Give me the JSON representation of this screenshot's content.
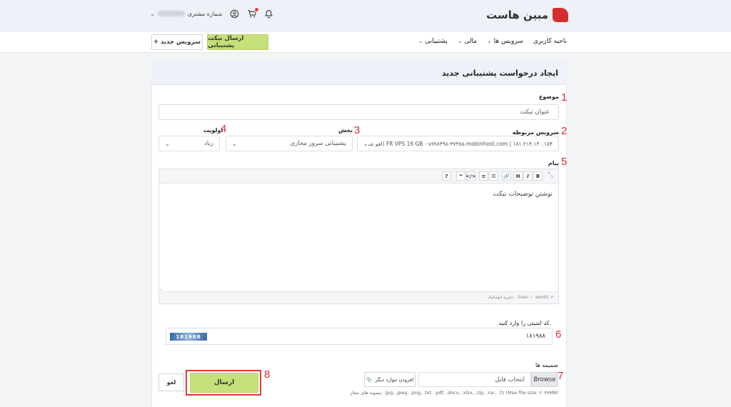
{
  "header": {
    "brand": "مبین هاست",
    "customer_label": "شماره مشتری",
    "icons": [
      "user-circle-icon",
      "cart-icon",
      "bell-icon"
    ]
  },
  "nav": {
    "items": [
      "ناحیه کاربری",
      "سرویس ها",
      "مالی",
      "پشتیبانی"
    ],
    "submit_ticket": "ارسال تیکت پشتیبانی",
    "new_service": "+ سرویس جدید"
  },
  "panel": {
    "title": "ایجاد درخواست پشتیبانی جدید",
    "subject_label": "موضوع",
    "subject_placeholder": "عنوان تیکت",
    "service_label": "سرویس مربوطه",
    "service_value": "FR VPS 16 GB - vm۸۳۹۸-۳۷۳۸۵.mobinhost.com | ۱۸۱.۲۱۴.۱۴۰.۱۵۴ (لغو شده)",
    "department_label": "بخش",
    "department_value": "پشتیبانی سرور مجازی",
    "priority_label": "اولویت",
    "priority_value": "زیاد",
    "message_label": "پیام",
    "message_placeholder": "نوشتن توضیحات تیکت",
    "editor_footer": {
      "words": "words: ۳",
      "lines": "lines: ۱",
      "autosave": "ذخیره اتوماتیک"
    },
    "captcha_label": "کد امنیتی را وارد کنید.",
    "captcha_value": "۱۸۱۹۸۸",
    "captcha_image_text": "181988",
    "attachments_label": "ضمیمه ها",
    "browse": "Browse",
    "file_placeholder": "انتخاب فایل",
    "add_more": "افزودن موارد دیگر",
    "allowed_ext": "پسوند های مجاز: .jpg, .jpeg, .png, .txt, .pdf, .docx, .xlsx, .zip, .rar, .7z (Max file size: ۲۰۴۸MB)",
    "submit": "ارسال",
    "cancel": "لغو"
  },
  "annotations": [
    "1",
    "2",
    "3",
    "4",
    "5",
    "6",
    "7",
    "8"
  ],
  "colors": {
    "accent_green": "#c6e07a",
    "annotation_red": "#d32f2f"
  }
}
